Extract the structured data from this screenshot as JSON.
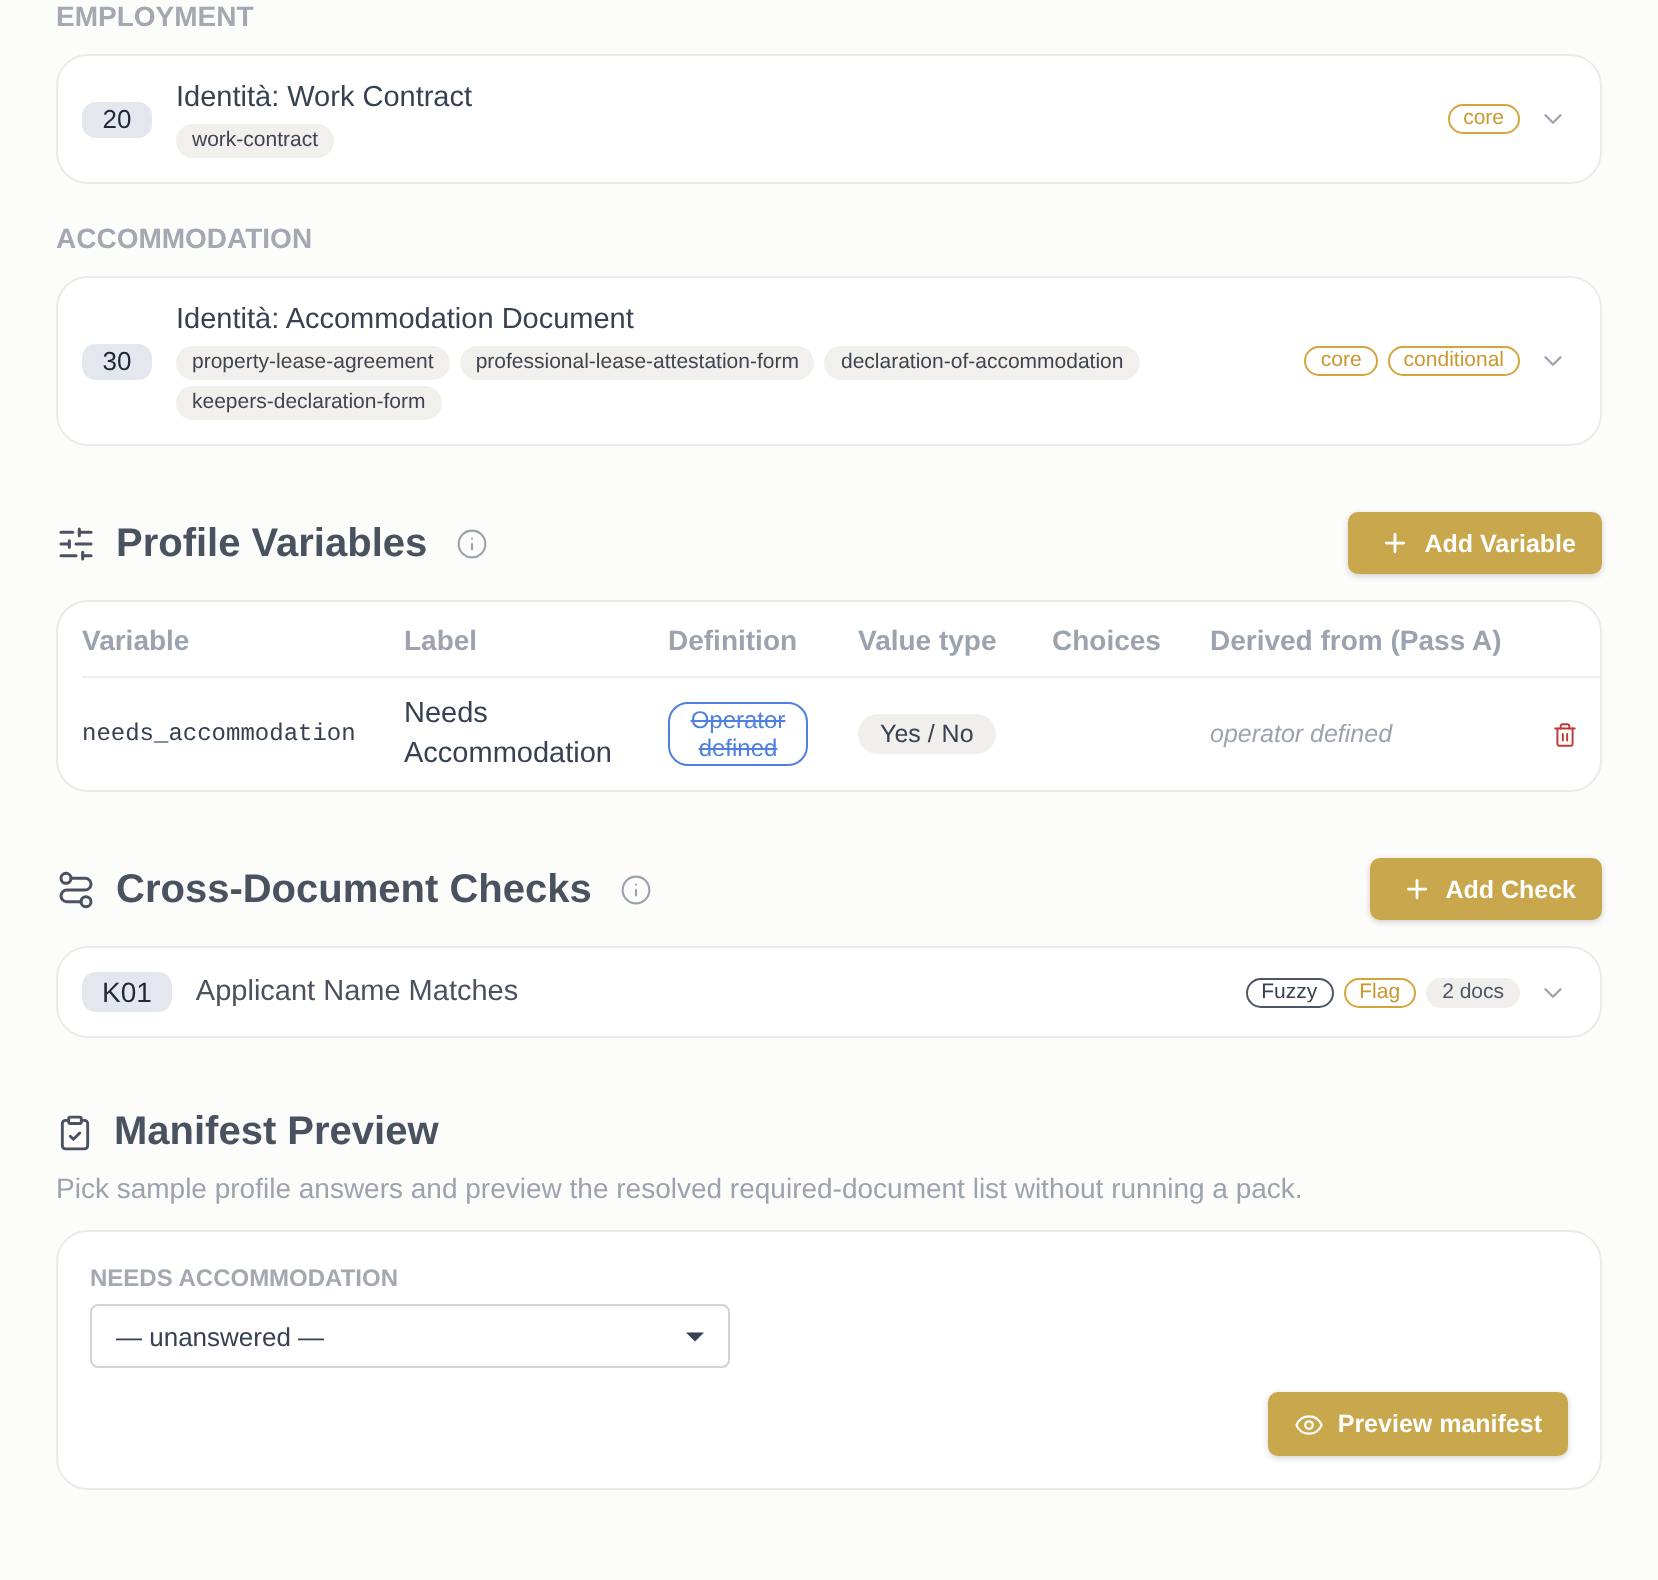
{
  "document_groups": [
    {
      "heading": "EMPLOYMENT",
      "documents": [
        {
          "number": "20",
          "title": "Identità: Work Contract",
          "tags": [
            "work-contract"
          ],
          "badges": [
            {
              "label": "core",
              "kind": "requirement"
            }
          ],
          "expanded": false
        }
      ]
    },
    {
      "heading": "ACCOMMODATION",
      "documents": [
        {
          "number": "30",
          "title": "Identità: Accommodation Document",
          "tags": [
            "property-lease-agreement",
            "professional-lease-attestation-form",
            "declaration-of-accommodation",
            "keepers-declaration-form"
          ],
          "badges": [
            {
              "label": "core",
              "kind": "requirement"
            },
            {
              "label": "conditional",
              "kind": "requirement"
            }
          ],
          "expanded": false
        }
      ]
    }
  ],
  "profile_variables": {
    "title": "Profile Variables",
    "add_button": "Add Variable",
    "columns": [
      "Variable",
      "Label",
      "Definition",
      "Value type",
      "Choices",
      "Derived from (Pass A)"
    ],
    "rows": [
      {
        "variable": "needs_accommodation",
        "label": "Needs Accommodation",
        "definition": "Operator defined",
        "value_type": "Yes / No",
        "derived_from": "operator defined"
      }
    ]
  },
  "cross_document_checks": {
    "title": "Cross-Document Checks",
    "add_button": "Add Check",
    "checks": [
      {
        "code": "K01",
        "name": "Applicant Name Matches",
        "badges": [
          {
            "label": "Fuzzy",
            "kind": "mode"
          },
          {
            "label": "Flag",
            "kind": "severity"
          },
          {
            "label": "2 docs",
            "kind": "count"
          }
        ],
        "expanded": false
      }
    ]
  },
  "manifest_preview": {
    "title": "Manifest Preview",
    "description": "Pick sample profile answers and preview the resolved required-document list without running a pack.",
    "fields": [
      {
        "label": "NEEDS ACCOMMODATION",
        "value": "— unanswered —"
      }
    ],
    "button": "Preview manifest"
  }
}
